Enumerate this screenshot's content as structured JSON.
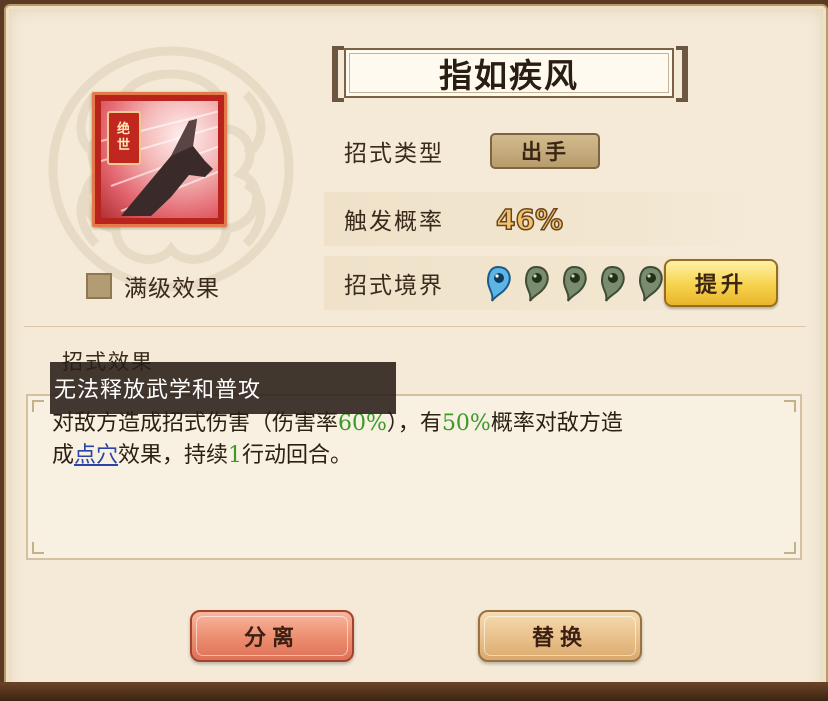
{
  "skill": {
    "name": "指如疾风",
    "rank_tag": [
      "绝",
      "世"
    ],
    "max_level_label": "满级效果"
  },
  "info": {
    "type_label": "招式类型",
    "type_value": "出手",
    "rate_label": "触发概率",
    "rate_value": "46%",
    "realm_label": "招式境界",
    "realm_level": 1,
    "realm_max": 5,
    "upgrade_label": "提升"
  },
  "effects": {
    "heading": "招式效果",
    "tooltip": "无法释放武学和普攻",
    "line1_a": "对敌方造成招式伤害（伤害率",
    "line1_b": "60%",
    "line1_c": "），有",
    "line1_d": "50%",
    "line1_e": "概率对敌方造",
    "line2_a": "成",
    "line2_link": "点穴",
    "line2_b": "效果，持续",
    "line2_c": "1",
    "line2_d": "行动回合。"
  },
  "buttons": {
    "split": "分离",
    "replace": "替换"
  },
  "colors": {
    "panel_bg": "#f4ead7",
    "highlight_green": "#3a9a2a",
    "link_blue": "#2a44a8",
    "gold": "#f6d24c"
  }
}
